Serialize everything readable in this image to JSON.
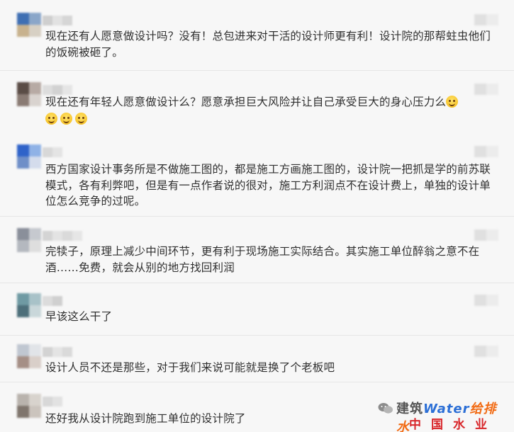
{
  "comments": [
    {
      "text": "现在还有人愿意做设计吗？没有！总包进来对干活的设计师更有利！设计院的那帮蛀虫他们的饭碗被砸了。",
      "emoji_count": 0
    },
    {
      "text": "现在还有年轻人愿意做设计么？愿意承担巨大风险并让自己承受巨大的身心压力么",
      "emoji_count": 4
    },
    {
      "text": "西方国家设计事务所是不做施工图的，都是施工方画施工图的，设计院一把抓是学的前苏联模式，各有利弊吧，但是有一点作者说的很对，施工方利润点不在设计费上，单独的设计单位怎么竞争的过呢。",
      "emoji_count": 0
    },
    {
      "text": "完犊子，原理上减少中间环节，更有利于现场施工实际结合。其实施工单位醉翁之意不在酒……免费，就会从别的地方找回利润",
      "emoji_count": 0
    },
    {
      "text": "早该这么干了",
      "emoji_count": 0
    },
    {
      "text": "设计人员不还是那些，对于我们来说可能就是换了个老板吧",
      "emoji_count": 0
    },
    {
      "text": "还好我从设计院跑到施工单位的设计院了",
      "emoji_count": 0
    }
  ],
  "emoji_icon": "smiling-face-icon",
  "watermark": {
    "top_text_a": "建筑",
    "top_text_b": "Water",
    "top_text_c": "给排水",
    "bottom_text": "中国水业网"
  },
  "colors": {
    "background": "#f7f7f7",
    "text": "#303030",
    "watermark_red": "#d8262a",
    "watermark_blue": "#2c6fd6",
    "watermark_orange": "#f26a12"
  }
}
